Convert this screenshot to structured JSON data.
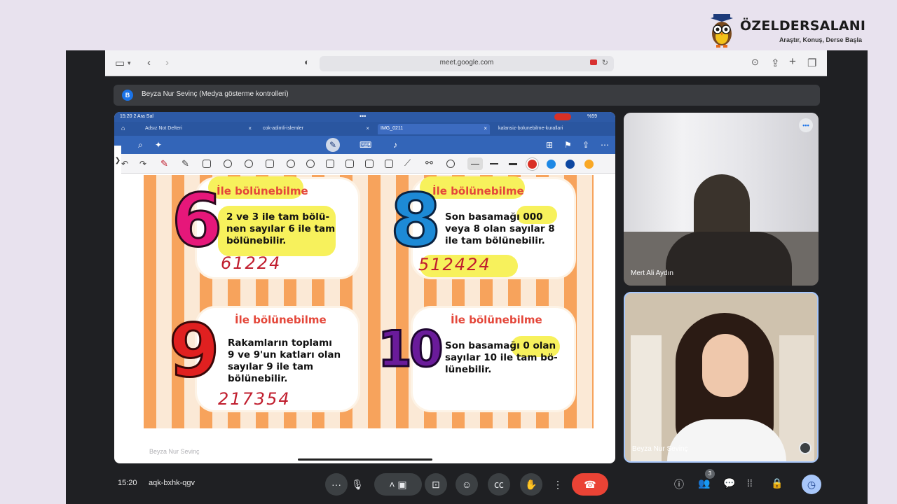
{
  "brand": {
    "name": "ÖZELDERSALANI",
    "slogan": "Araştır, Konuş, Derse Başla"
  },
  "browser": {
    "url": "meet.google.com"
  },
  "presenter": {
    "avatar_letter": "B",
    "text": "Beyza Nur Sevinç (Medya gösterme kontrolleri)"
  },
  "ipad": {
    "status_time": "15:20",
    "status_date": "2 Ara Sal",
    "battery": "%59",
    "tabs": [
      {
        "label": "Adsız Not Defteri"
      },
      {
        "label": "cok-adimli-islemler"
      },
      {
        "label": "IMG_0211"
      },
      {
        "label": "kalansiz-bolunebilme-kurallari"
      }
    ],
    "pen_colors": [
      "#d93025",
      "#1e88e5",
      "#0d47a1",
      "#f9a825"
    ]
  },
  "slide": {
    "cards": [
      {
        "title": "İle bölünebilme",
        "number": "6",
        "number_color": "#e6177a",
        "rule_lines": [
          "2 ve 3 ile tam bölü-",
          "nen sayılar 6 ile tam",
          "bölünebilir."
        ],
        "example": "61224"
      },
      {
        "title": "İle bölünebilme",
        "number": "8",
        "number_color": "#1d8ad6",
        "rule_lines": [
          "Son basamağı 000",
          "veya 8 olan sayılar 8",
          "ile tam bölünebilir."
        ],
        "example": "512424"
      },
      {
        "title": "İle bölünebilme",
        "number": "9",
        "number_color": "#e02020",
        "rule_lines": [
          "Rakamların toplamı",
          "9 ve 9'un katları olan",
          "sayılar 9 ile tam",
          "bölünebilir."
        ],
        "example": "217354"
      },
      {
        "title": "İle bölünebilme",
        "number": "10",
        "number_color": "#6a1b9a",
        "rule_lines": [
          "Son basamağı 0 olan",
          "sayılar 10 ile tam bö-",
          "lünebilir."
        ],
        "example": ""
      }
    ],
    "screen_name": "Beyza Nur Sevinç"
  },
  "participants": [
    {
      "name": "Mert Ali Aydın"
    },
    {
      "name": "Beyza Nur Sevinç"
    }
  ],
  "meet": {
    "time": "15:20",
    "code": "aqk-bxhk-qgv",
    "people_count": "3"
  },
  "colors": {
    "end_call": "#ea4335",
    "accent": "#1a73e8"
  }
}
